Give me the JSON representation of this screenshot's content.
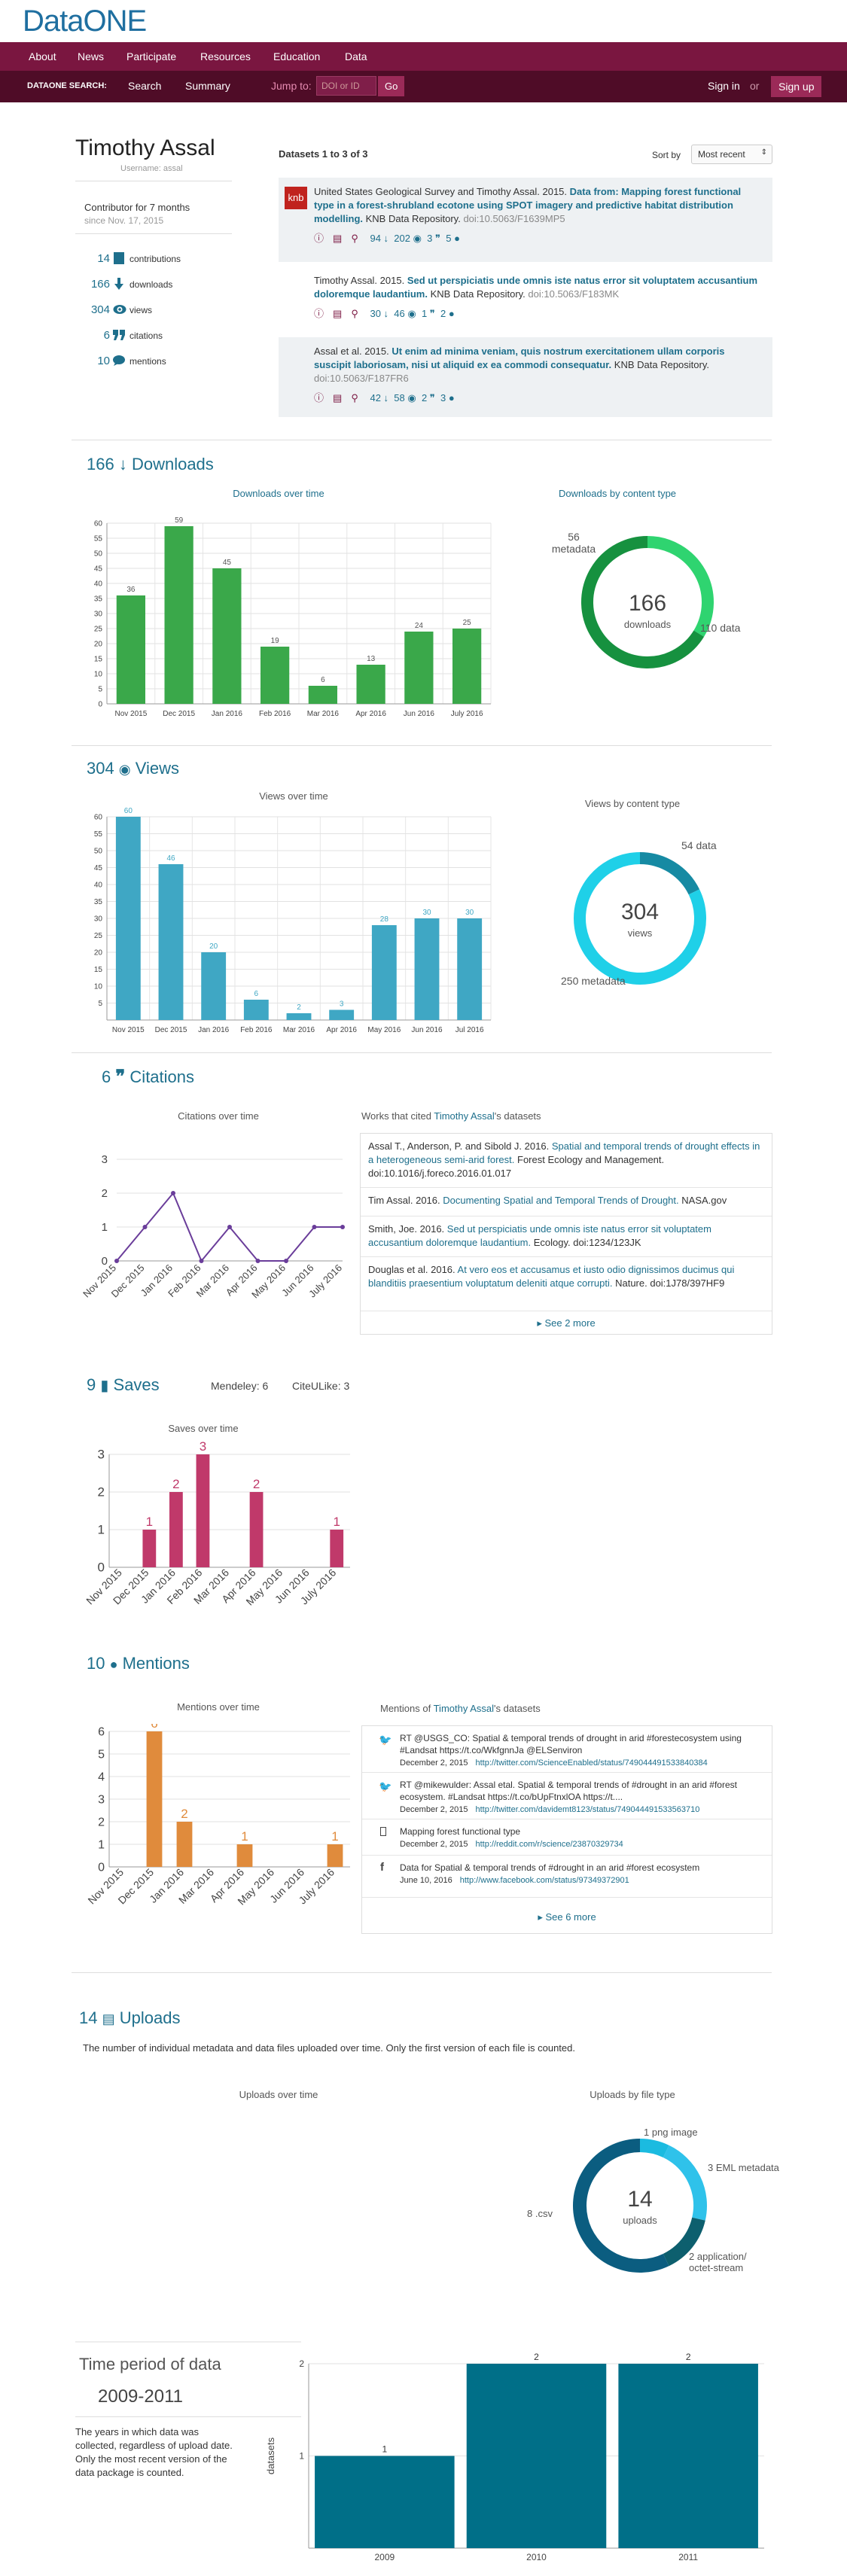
{
  "brand": {
    "logo": "DataONE"
  },
  "nav": {
    "items": [
      "About",
      "News",
      "Participate",
      "Resources",
      "Education",
      "Data"
    ]
  },
  "searchbar": {
    "label": "DATAONE SEARCH:",
    "search": "Search",
    "summary": "Summary",
    "jump_to": "Jump to:",
    "placeholder": "DOI or ID",
    "go": "Go",
    "sign_in": "Sign in",
    "or": "or",
    "sign_up": "Sign up"
  },
  "profile": {
    "name": "Timothy Assal",
    "username": "Username: assal",
    "contributor": "Contributor for 7 months",
    "since": "since Nov. 17, 2015",
    "stats": [
      {
        "value": "14",
        "label": "contributions"
      },
      {
        "value": "166",
        "label": "downloads"
      },
      {
        "value": "304",
        "label": "views"
      },
      {
        "value": "6",
        "label": "citations"
      },
      {
        "value": "10",
        "label": "mentions"
      }
    ]
  },
  "datasets": {
    "header": "Datasets 1 to 3 of 3",
    "sort_label": "Sort by",
    "sort_value": "Most recent",
    "items": [
      {
        "badge": "knb",
        "authors": "United States Geological Survey and Timothy Assal. 2015.",
        "title": "Data from: Mapping forest functional type in a forest-shrubland ecotone using SPOT imagery and predictive habitat distribution modelling.",
        "repo": "KNB Data Repository.",
        "doi": "doi:10.5063/F1639MP5",
        "downloads": "94",
        "views": "202",
        "citations": "3",
        "mentions": "5"
      },
      {
        "authors": "Timothy Assal. 2015.",
        "title": "Sed ut perspiciatis unde omnis iste natus error sit voluptatem accusantium doloremque laudantium.",
        "repo": "KNB Data Repository.",
        "doi": "doi:10.5063/F183MK",
        "downloads": "30",
        "views": "46",
        "citations": "1",
        "mentions": "2"
      },
      {
        "authors": "Assal et al. 2015.",
        "title": "Ut enim ad minima veniam, quis nostrum exercitationem ullam corporis suscipit laboriosam, nisi ut aliquid ex ea commodi consequatur.",
        "repo": "KNB Data Repository.",
        "doi": "doi:10.5063/F187FR6",
        "downloads": "42",
        "views": "58",
        "citations": "2",
        "mentions": "3"
      }
    ]
  },
  "downloads": {
    "count": "166",
    "label": "Downloads",
    "chart_title": "Downloads over time",
    "donut_title": "Downloads by content type",
    "donut_center": "166",
    "donut_center_label": "downloads",
    "donut_a": "56",
    "donut_a_label": "metadata",
    "donut_b": "110 data"
  },
  "views": {
    "count": "304",
    "label": "Views",
    "chart_title": "Views over time",
    "donut_title": "Views by content type",
    "donut_center": "304",
    "donut_center_label": "views",
    "donut_a": "54 data",
    "donut_b": "250 metadata"
  },
  "citations": {
    "count": "6",
    "label": "Citations",
    "chart_title": "Citations over time",
    "works_prefix": "Works that cited",
    "works_name": "Timothy Assal",
    "works_suffix": "'s datasets",
    "works": [
      {
        "authors": "Assal T., Anderson, P. and Sibold J. 2016.",
        "title": "Spatial and temporal trends of drought effects in a heterogeneous semi-arid forest.",
        "source": "Forest Ecology and Management. doi:10.1016/j.foreco.2016.01.017"
      },
      {
        "authors": "Tim Assal. 2016.",
        "title": "Documenting Spatial and Temporal Trends of Drought.",
        "source": "NASA.gov"
      },
      {
        "authors": "Smith, Joe. 2016.",
        "title": "Sed ut perspiciatis unde omnis iste natus error sit voluptatem accusantium doloremque laudantium.",
        "source": "Ecology. doi:1234/123JK"
      },
      {
        "authors": "Douglas et al. 2016.",
        "title": "At vero eos et accusamus et iusto odio dignissimos ducimus qui blanditiis praesentium voluptatum deleniti atque corrupti.",
        "source": "Nature. doi:1J78/397HF9"
      }
    ],
    "more": "See 2 more"
  },
  "saves": {
    "count": "9",
    "label": "Saves",
    "mendeley": "Mendeley: 6",
    "citeulike": "CiteULike: 3",
    "chart_title": "Saves over time"
  },
  "mentions": {
    "count": "10",
    "label": "Mentions",
    "chart_title": "Mentions over time",
    "list_prefix": "Mentions of",
    "list_name": "Timothy Assal",
    "list_suffix": "'s datasets",
    "items": [
      {
        "icon": "twitter-icon",
        "text": "RT @USGS_CO: Spatial & temporal trends of drought in arid #forestecosystem using #Landsat https://t.co/WkfgnnJa @ELSenviron",
        "date": "December 2, 2015",
        "url": "http://twitter.com/ScienceEnabled/status/749044491533840384"
      },
      {
        "icon": "twitter-icon",
        "text": "RT @mikewulder: Assal etal. Spatial & temporal trends of #drought in an arid #forest ecosystem. #Landsat https://t.co/bUpFtnxlOA https://t....",
        "date": "December 2, 2015",
        "url": "http://twitter.com/davidemt8123/status/749044491533563710"
      },
      {
        "icon": "reddit-icon",
        "text": "Mapping forest functional type",
        "date": "December 2, 2015",
        "url": "http://reddit.com/r/science/23870329734"
      },
      {
        "icon": "facebook-icon",
        "text": "Data for Spatial & temporal trends of #drought in an arid #forest ecosystem",
        "date": "June 10, 2016",
        "url": "http://www.facebook.com/status/97349372901"
      }
    ],
    "more": "See 6 more"
  },
  "uploads": {
    "count": "14",
    "label": "Uploads",
    "desc": "The number of individual metadata and data files uploaded over time. Only the first version of each file is counted.",
    "chart_title": "Uploads over time",
    "donut_title": "Uploads by file type",
    "donut_center": "14",
    "donut_center_label": "uploads",
    "l_png": "1 png image",
    "l_eml": "3 EML metadata",
    "l_csv": "8 .csv",
    "l_oct": "2 application/ octet-stream"
  },
  "period": {
    "title": "Time period of data",
    "range": "2009-2011",
    "desc": "The years in which data was collected, regardless of upload date. Only the most recent version of the data package is counted.",
    "ylabel": "datasets"
  },
  "chart_data": [
    {
      "type": "bar",
      "id": "downloads",
      "title": "Downloads over time",
      "categories": [
        "Nov 2015",
        "Dec 2015",
        "Jan 2016",
        "Feb 2016",
        "Mar 2016",
        "Apr 2016",
        "Jun 2016",
        "July 2016"
      ],
      "values": [
        36,
        59,
        45,
        19,
        6,
        13,
        24,
        25
      ],
      "ylim": [
        0,
        60
      ],
      "yticks": [
        0,
        5,
        10,
        15,
        20,
        25,
        30,
        35,
        40,
        45,
        50,
        55,
        60
      ],
      "color": "#3aa84a"
    },
    {
      "type": "pie",
      "id": "downloads-type",
      "title": "Downloads by content type",
      "labels": [
        "metadata",
        "data"
      ],
      "values": [
        56,
        110
      ],
      "colors": [
        "#2fd470",
        "#16913f"
      ]
    },
    {
      "type": "bar",
      "id": "views",
      "title": "Views over time",
      "categories": [
        "Nov 2015",
        "Dec 2015",
        "Jan 2016",
        "Feb 2016",
        "Mar 2016",
        "Apr 2016",
        "May 2016",
        "Jun 2016",
        "Jul 2016"
      ],
      "values": [
        60,
        46,
        20,
        6,
        2,
        3,
        28,
        30,
        30
      ],
      "ylim": [
        0,
        60
      ],
      "yticks": [
        5,
        10,
        15,
        20,
        25,
        30,
        35,
        40,
        45,
        50,
        55,
        60
      ],
      "color": "#3fa7c4"
    },
    {
      "type": "pie",
      "id": "views-type",
      "title": "Views by content type",
      "labels": [
        "data",
        "metadata"
      ],
      "values": [
        54,
        250
      ],
      "colors": [
        "#168aa3",
        "#1fd0e8"
      ]
    },
    {
      "type": "line",
      "id": "citations",
      "title": "Citations over time",
      "categories": [
        "Nov 2015",
        "Dec 2015",
        "Jan 2016",
        "Feb 2016",
        "Mar 2016",
        "Apr 2016",
        "May 2016",
        "Jun 2016",
        "July 2016"
      ],
      "values": [
        0,
        1,
        2,
        0,
        1,
        0,
        0,
        1,
        1
      ],
      "ylim": [
        0,
        3
      ],
      "yticks": [
        0,
        1,
        2,
        3
      ],
      "color": "#6a3d9a"
    },
    {
      "type": "bar",
      "id": "saves",
      "title": "Saves over time",
      "categories": [
        "Nov 2015",
        "Dec 2015",
        "Jan 2016",
        "Feb 2016",
        "Mar 2016",
        "Apr 2016",
        "May 2016",
        "Jun 2016",
        "July 2016"
      ],
      "values": [
        0,
        1,
        2,
        3,
        0,
        2,
        0,
        0,
        1
      ],
      "ylim": [
        0,
        3
      ],
      "yticks": [
        0,
        1,
        2,
        3
      ],
      "color": "#c0396a"
    },
    {
      "type": "bar",
      "id": "mentions",
      "title": "Mentions over time",
      "categories": [
        "Nov 2015",
        "Dec 2015",
        "Jan 2016",
        "Mar 2016",
        "Apr 2016",
        "May 2016",
        "Jun 2016",
        "July 2016"
      ],
      "values": [
        0,
        6,
        2,
        0,
        1,
        0,
        0,
        1
      ],
      "ylim": [
        0,
        6
      ],
      "yticks": [
        0,
        1,
        2,
        3,
        4,
        5,
        6
      ],
      "color": "#e08b3c"
    },
    {
      "type": "pie",
      "id": "uploads-type",
      "title": "Uploads by file type",
      "labels": [
        "png image",
        "EML metadata",
        "application/octet-stream",
        ".csv"
      ],
      "values": [
        1,
        3,
        2,
        8
      ],
      "colors": [
        "#1bbbe0",
        "#2fc2ea",
        "#0d5f6e",
        "#0b5d80"
      ]
    },
    {
      "type": "bar",
      "id": "period",
      "categories": [
        "2009",
        "2010",
        "2011"
      ],
      "values": [
        1,
        2,
        2
      ],
      "ylim": [
        0,
        2
      ],
      "yticks": [
        1,
        2
      ],
      "ylabel": "datasets",
      "color": "#006f88"
    }
  ]
}
